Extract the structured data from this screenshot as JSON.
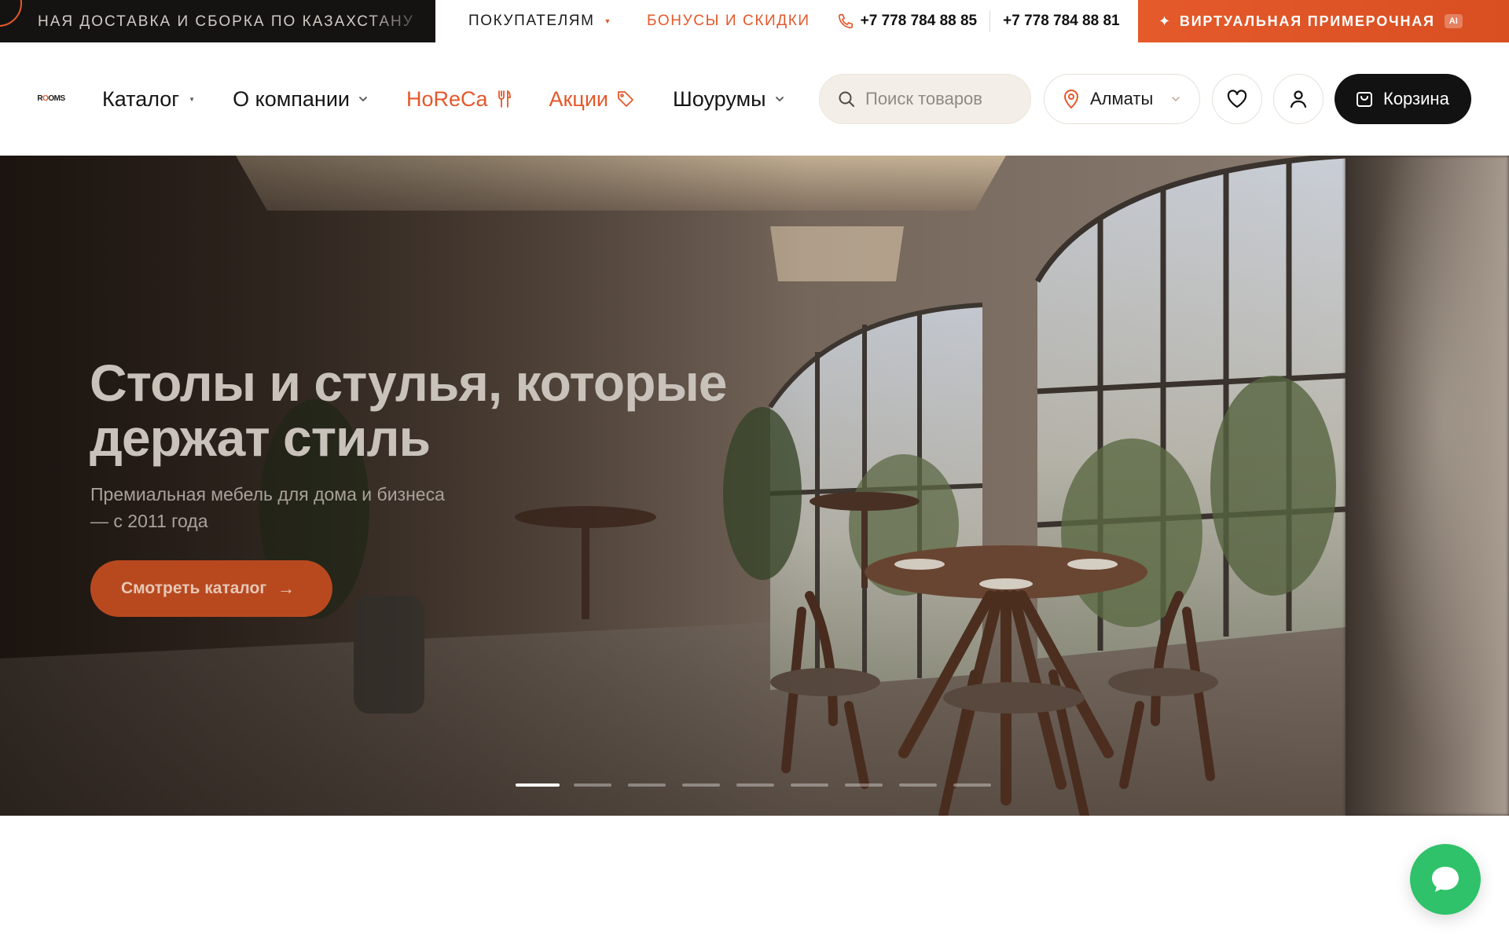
{
  "topbar": {
    "marquee_text": "НАЯ ДОСТАВКА И СБОРКА ПО КАЗАХСТАНУ",
    "links": {
      "buyers": "ПОКУПАТЕЛЯМ",
      "bonuses": "БОНУСЫ И СКИДКИ"
    },
    "phones": [
      "+7 778 784 88 85",
      "+7 778 784 88 81"
    ],
    "virtual_fitting": {
      "label": "ВИРТУАЛЬНАЯ ПРИМЕРОЧНАЯ",
      "badge": "AI"
    }
  },
  "header": {
    "logo": {
      "text_a": "R",
      "text_b": "O",
      "text_c": "OMS"
    },
    "nav": {
      "catalog": "Каталог",
      "about": "О компании",
      "horeca": "HoReCa",
      "sales": "Акции",
      "showrooms": "Шоурумы"
    },
    "search": {
      "placeholder": "Поиск товаров",
      "value": ""
    },
    "city": "Алматы",
    "cart_label": "Корзина"
  },
  "hero": {
    "title_line1": "Столы и стулья, которые",
    "title_line2": "держат стиль",
    "subtitle_line1": "Премиальная мебель для дома и бизнеса",
    "subtitle_line2": "— с 2011 года",
    "cta_label": "Смотреть каталог",
    "slides_total": 9,
    "active_slide": 1
  },
  "colors": {
    "accent": "#e4582a",
    "dark": "#121212",
    "chat": "#2fc26a",
    "search_bg": "#f3eee7"
  },
  "icons": [
    "phone-icon",
    "sparkle-icon",
    "fork-knife-icon",
    "tag-icon",
    "search-icon",
    "location-pin-icon",
    "heart-icon",
    "user-icon",
    "shopping-bag-icon",
    "arrow-right-icon",
    "chat-bubble-icon"
  ]
}
